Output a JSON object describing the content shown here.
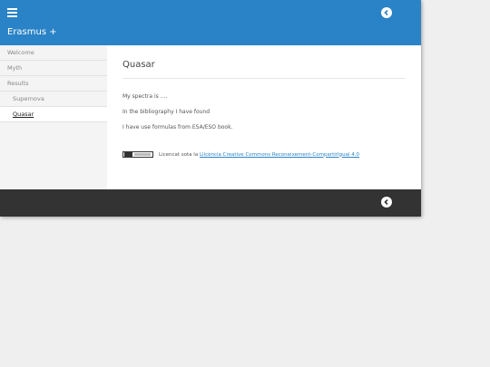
{
  "header": {
    "site_title": "Erasmus +"
  },
  "sidebar": {
    "items": [
      {
        "label": "Welcome"
      },
      {
        "label": "Myth"
      },
      {
        "label": "Results"
      },
      {
        "label": "Supernova"
      },
      {
        "label": "Quasar"
      }
    ],
    "active_index": 4
  },
  "main": {
    "title": "Quasar",
    "paragraphs": [
      "My spectra is ....",
      "In the bibliography I have found",
      "I have use formulas from ESA/ESO book."
    ],
    "license": {
      "prefix": "Licencat sota la",
      "link_text": "Llicència Creative Commons Reconeixement-CompartirIgual 4.0"
    }
  },
  "colors": {
    "accent": "#2a83c6",
    "footer": "#333333",
    "background": "#efefef"
  },
  "icons": {
    "menu": "hamburger-menu-icon",
    "back": "chevron-left-circle-icon"
  }
}
